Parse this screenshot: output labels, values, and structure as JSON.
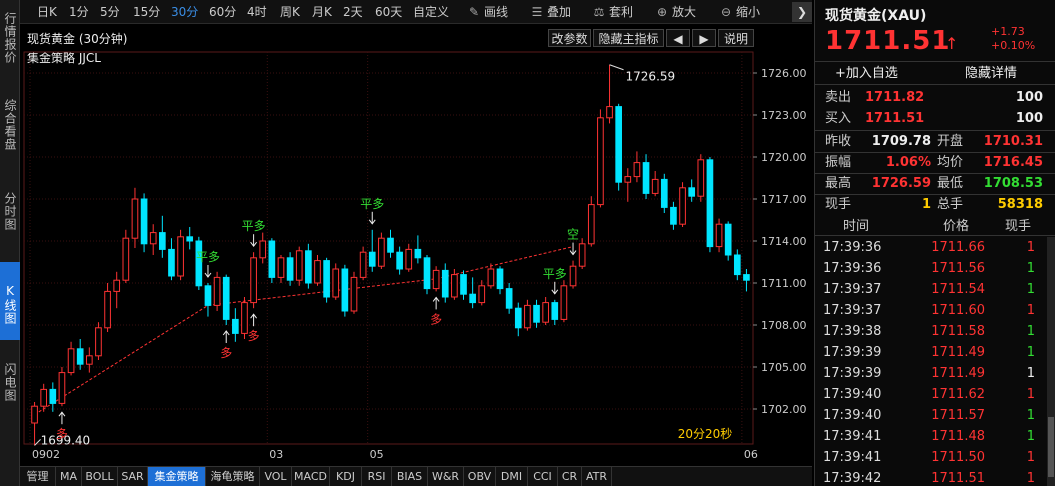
{
  "leftbar": {
    "tabs": [
      {
        "label": "行情报价",
        "active": false
      },
      {
        "label": "综合看盘",
        "active": false
      },
      {
        "label": "分时图",
        "active": false
      },
      {
        "label": "K线图",
        "active": true
      },
      {
        "label": "闪电图",
        "active": false
      }
    ]
  },
  "toolbar": {
    "periods": [
      "日K",
      "1分",
      "5分",
      "15分",
      "30分",
      "60分",
      "4时",
      "周K",
      "月K",
      "2天",
      "60天",
      "自定义"
    ],
    "active_period": "30分",
    "tools": [
      {
        "label": "画线",
        "icon": "pencil-icon"
      },
      {
        "label": "叠加",
        "icon": "stack-icon"
      },
      {
        "label": "套利",
        "icon": "arbitrage-icon"
      },
      {
        "label": "放大",
        "icon": "zoom-in-icon"
      },
      {
        "label": "缩小",
        "icon": "zoom-out-icon"
      }
    ],
    "nav_glyph": "❯"
  },
  "chart_header": {
    "title": "现货黄金 (30分钟)",
    "strategy": "集金策略 JJCL",
    "buttons": [
      "改参数",
      "隐藏主指标",
      "◀",
      "▶",
      "说明"
    ]
  },
  "chart_data": {
    "type": "candlestick",
    "ylim": [
      1699.5,
      1727.5
    ],
    "y_ticks": [
      1702.0,
      1705.0,
      1708.0,
      1711.0,
      1714.0,
      1717.0,
      1720.0,
      1723.0,
      1726.0
    ],
    "x_labels": [
      {
        "label": "0902",
        "index": 0
      },
      {
        "label": "03",
        "index": 26
      },
      {
        "label": "05",
        "index": 37
      },
      {
        "label": "06",
        "index": 78
      }
    ],
    "annotations": {
      "high_label": "1726.59",
      "low_label": "1699.40",
      "timer": "20分20秒"
    },
    "signals": [
      {
        "text": "多",
        "index": 3,
        "dir": "up"
      },
      {
        "text": "平多",
        "index": 19,
        "dir": "down"
      },
      {
        "text": "多",
        "index": 21,
        "dir": "up"
      },
      {
        "text": "平多",
        "index": 24,
        "dir": "down"
      },
      {
        "text": "多",
        "index": 24,
        "dir": "up"
      },
      {
        "text": "平多",
        "index": 37,
        "dir": "down"
      },
      {
        "text": "多",
        "index": 44,
        "dir": "up"
      },
      {
        "text": "平多",
        "index": 57,
        "dir": "down"
      },
      {
        "text": "空",
        "index": 59,
        "dir": "down"
      }
    ],
    "trend_line": [
      {
        "index": 0,
        "value": 1701.6
      },
      {
        "index": 19,
        "value": 1709.4
      },
      {
        "index": 44,
        "value": 1711.3
      },
      {
        "index": 59,
        "value": 1713.6
      }
    ],
    "candles": [
      [
        1701.0,
        1702.5,
        1699.4,
        1702.2
      ],
      [
        1702.2,
        1703.8,
        1701.8,
        1703.4
      ],
      [
        1703.4,
        1703.9,
        1701.8,
        1702.4
      ],
      [
        1702.4,
        1705.0,
        1702.2,
        1704.6
      ],
      [
        1704.6,
        1706.8,
        1704.4,
        1706.3
      ],
      [
        1706.3,
        1707.0,
        1704.8,
        1705.2
      ],
      [
        1705.2,
        1706.4,
        1704.6,
        1705.8
      ],
      [
        1705.8,
        1708.2,
        1705.5,
        1707.8
      ],
      [
        1707.8,
        1711.0,
        1707.5,
        1710.4
      ],
      [
        1710.4,
        1711.8,
        1709.2,
        1711.2
      ],
      [
        1711.2,
        1714.8,
        1711.0,
        1714.2
      ],
      [
        1714.2,
        1717.8,
        1713.5,
        1717.0
      ],
      [
        1717.0,
        1717.4,
        1713.2,
        1713.8
      ],
      [
        1713.8,
        1715.2,
        1713.0,
        1714.6
      ],
      [
        1714.6,
        1715.8,
        1712.8,
        1713.4
      ],
      [
        1713.4,
        1714.2,
        1711.2,
        1711.5
      ],
      [
        1711.5,
        1714.8,
        1711.2,
        1714.3
      ],
      [
        1714.3,
        1715.0,
        1713.4,
        1714.0
      ],
      [
        1714.0,
        1714.3,
        1710.5,
        1710.8
      ],
      [
        1710.8,
        1711.0,
        1708.6,
        1709.4
      ],
      [
        1709.4,
        1711.8,
        1709.0,
        1711.4
      ],
      [
        1711.4,
        1711.6,
        1708.0,
        1708.4
      ],
      [
        1708.4,
        1709.2,
        1706.8,
        1707.4
      ],
      [
        1707.4,
        1710.0,
        1707.0,
        1709.6
      ],
      [
        1709.6,
        1713.2,
        1709.2,
        1712.8
      ],
      [
        1712.8,
        1714.6,
        1712.4,
        1714.0
      ],
      [
        1714.0,
        1714.2,
        1711.0,
        1711.4
      ],
      [
        1711.4,
        1713.0,
        1711.0,
        1712.8
      ],
      [
        1712.8,
        1713.2,
        1710.8,
        1711.2
      ],
      [
        1711.2,
        1713.6,
        1710.8,
        1713.3
      ],
      [
        1713.3,
        1713.8,
        1710.6,
        1711.0
      ],
      [
        1711.0,
        1713.0,
        1710.8,
        1712.6
      ],
      [
        1712.6,
        1712.8,
        1709.6,
        1710.0
      ],
      [
        1710.0,
        1712.4,
        1709.8,
        1712.0
      ],
      [
        1712.0,
        1712.3,
        1708.6,
        1709.0
      ],
      [
        1709.0,
        1711.8,
        1708.8,
        1711.4
      ],
      [
        1711.4,
        1713.6,
        1711.2,
        1713.2
      ],
      [
        1713.2,
        1714.8,
        1711.8,
        1712.2
      ],
      [
        1712.2,
        1714.6,
        1712.0,
        1714.2
      ],
      [
        1714.2,
        1714.8,
        1712.8,
        1713.2
      ],
      [
        1713.2,
        1713.6,
        1711.6,
        1712.0
      ],
      [
        1712.0,
        1713.8,
        1711.8,
        1713.4
      ],
      [
        1713.4,
        1714.4,
        1712.4,
        1712.8
      ],
      [
        1712.8,
        1713.0,
        1710.2,
        1710.6
      ],
      [
        1710.6,
        1712.2,
        1710.4,
        1711.9
      ],
      [
        1711.9,
        1712.4,
        1709.6,
        1710.0
      ],
      [
        1710.0,
        1712.0,
        1709.8,
        1711.6
      ],
      [
        1711.6,
        1711.9,
        1709.8,
        1710.2
      ],
      [
        1710.2,
        1711.4,
        1709.2,
        1709.6
      ],
      [
        1709.6,
        1711.2,
        1709.4,
        1710.8
      ],
      [
        1710.8,
        1712.4,
        1710.6,
        1712.0
      ],
      [
        1712.0,
        1712.2,
        1710.2,
        1710.6
      ],
      [
        1710.6,
        1711.0,
        1708.8,
        1709.2
      ],
      [
        1709.2,
        1709.6,
        1707.2,
        1707.8
      ],
      [
        1707.8,
        1709.8,
        1707.6,
        1709.4
      ],
      [
        1709.4,
        1709.8,
        1707.8,
        1708.2
      ],
      [
        1708.2,
        1710.0,
        1708.0,
        1709.6
      ],
      [
        1709.6,
        1709.8,
        1708.0,
        1708.4
      ],
      [
        1708.4,
        1711.2,
        1708.2,
        1710.8
      ],
      [
        1710.8,
        1712.6,
        1710.6,
        1712.2
      ],
      [
        1712.2,
        1714.2,
        1712.0,
        1713.8
      ],
      [
        1713.8,
        1717.2,
        1713.6,
        1716.6
      ],
      [
        1716.6,
        1723.4,
        1716.4,
        1722.8
      ],
      [
        1722.8,
        1726.59,
        1722.4,
        1723.6
      ],
      [
        1723.6,
        1723.8,
        1717.6,
        1718.2
      ],
      [
        1718.2,
        1719.2,
        1716.8,
        1718.6
      ],
      [
        1718.6,
        1720.4,
        1718.2,
        1719.6
      ],
      [
        1719.6,
        1720.2,
        1717.0,
        1717.4
      ],
      [
        1717.4,
        1719.0,
        1717.2,
        1718.4
      ],
      [
        1718.4,
        1718.8,
        1716.0,
        1716.4
      ],
      [
        1716.4,
        1716.8,
        1714.8,
        1715.2
      ],
      [
        1715.2,
        1718.2,
        1715.0,
        1717.8
      ],
      [
        1717.8,
        1718.4,
        1716.8,
        1717.2
      ],
      [
        1717.2,
        1720.2,
        1716.8,
        1719.8
      ],
      [
        1719.8,
        1720.0,
        1713.2,
        1713.6
      ],
      [
        1713.6,
        1715.6,
        1713.2,
        1715.2
      ],
      [
        1715.2,
        1715.4,
        1712.6,
        1713.0
      ],
      [
        1713.0,
        1713.4,
        1711.2,
        1711.6
      ],
      [
        1711.6,
        1712.0,
        1710.4,
        1711.2
      ]
    ]
  },
  "bottombar": {
    "tabs": [
      "管理",
      "MA",
      "BOLL",
      "SAR",
      "集金策略",
      "海龟策略",
      "VOL",
      "MACD",
      "KDJ",
      "RSI",
      "BIAS",
      "W&R",
      "OBV",
      "DMI",
      "CCI",
      "CR",
      "ATR"
    ],
    "active": "集金策略"
  },
  "quote": {
    "title": "现货黄金(XAU)",
    "price": "1711.51",
    "arrow": "↑",
    "change": "+1.73",
    "change_pct": "+0.10%",
    "add_watch": "+加入自选",
    "hide_detail": "隐藏详情",
    "sell_label": "卖出",
    "sell_price": "1711.82",
    "sell_vol": "100",
    "buy_label": "买入",
    "buy_price": "1711.51",
    "buy_vol": "100",
    "stats": [
      {
        "l1": "昨收",
        "v1": "1709.78",
        "c1": "white",
        "l2": "开盘",
        "v2": "1710.31",
        "c2": "red"
      },
      {
        "l1": "振幅",
        "v1": "1.06%",
        "c1": "red",
        "l2": "均价",
        "v2": "1716.45",
        "c2": "red"
      },
      {
        "l1": "最高",
        "v1": "1726.59",
        "c1": "red",
        "l2": "最低",
        "v2": "1708.53",
        "c2": "green"
      },
      {
        "l1": "现手",
        "v1": "1",
        "c1": "yellow",
        "l2": "总手",
        "v2": "58318",
        "c2": "yellow"
      }
    ],
    "tick_headers": [
      "时间",
      "价格",
      "现手"
    ],
    "ticks": [
      {
        "time": "17:39:36",
        "price": "1711.66",
        "vol": "1",
        "vc": "red"
      },
      {
        "time": "17:39:36",
        "price": "1711.56",
        "vol": "1",
        "vc": "green"
      },
      {
        "time": "17:39:37",
        "price": "1711.54",
        "vol": "1",
        "vc": "green"
      },
      {
        "time": "17:39:37",
        "price": "1711.60",
        "vol": "1",
        "vc": "red"
      },
      {
        "time": "17:39:38",
        "price": "1711.58",
        "vol": "1",
        "vc": "green"
      },
      {
        "time": "17:39:39",
        "price": "1711.49",
        "vol": "1",
        "vc": "green"
      },
      {
        "time": "17:39:39",
        "price": "1711.49",
        "vol": "1",
        "vc": "white"
      },
      {
        "time": "17:39:40",
        "price": "1711.62",
        "vol": "1",
        "vc": "red"
      },
      {
        "time": "17:39:40",
        "price": "1711.57",
        "vol": "1",
        "vc": "green"
      },
      {
        "time": "17:39:41",
        "price": "1711.48",
        "vol": "1",
        "vc": "green"
      },
      {
        "time": "17:39:41",
        "price": "1711.50",
        "vol": "1",
        "vc": "red"
      },
      {
        "time": "17:39:42",
        "price": "1711.51",
        "vol": "1",
        "vc": "red"
      }
    ]
  },
  "colors": {
    "up": "#ff3333",
    "down": "#00e5ff",
    "grid": "#3a1010",
    "trend": "#ff3333",
    "signal_up": "#ff3333",
    "signal_down": "#33dd33"
  }
}
